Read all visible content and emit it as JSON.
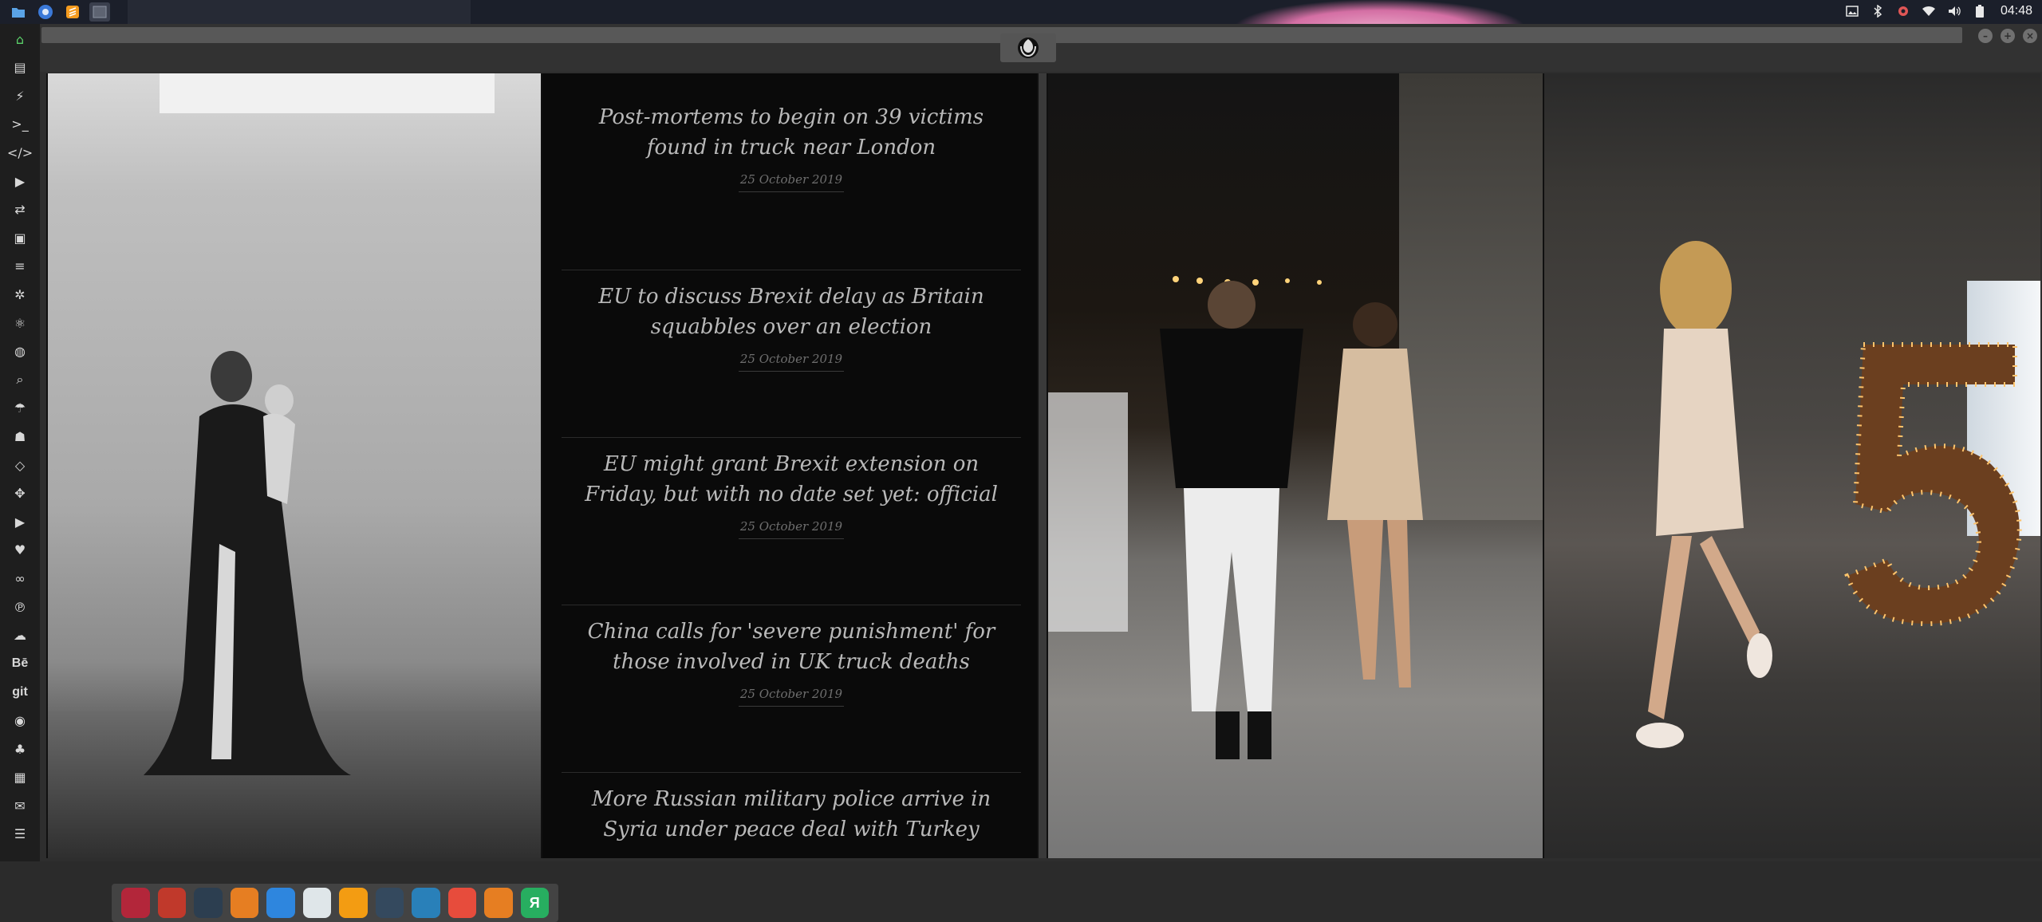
{
  "top_panel": {
    "clock": "04:48",
    "launchers": [
      "files-icon",
      "chromium-icon",
      "sublime-text-icon",
      "window-thumbnail-icon"
    ],
    "tray_icons": [
      "image-icon",
      "bluetooth-icon",
      "settings-gear-icon",
      "wifi-icon",
      "volume-icon",
      "battery-icon"
    ]
  },
  "left_launcher": {
    "items": [
      {
        "icon": "home-icon",
        "glyph": "⌂"
      },
      {
        "icon": "document-icon",
        "glyph": "▤"
      },
      {
        "icon": "bolt-icon",
        "glyph": "⚡"
      },
      {
        "icon": "terminal-icon",
        "glyph": ">_"
      },
      {
        "icon": "code-icon",
        "glyph": "</>"
      },
      {
        "icon": "play-icon",
        "glyph": "▶"
      },
      {
        "icon": "translate-icon",
        "glyph": "⇄"
      },
      {
        "icon": "image-icon",
        "glyph": "▣"
      },
      {
        "icon": "news-icon",
        "glyph": "≡"
      },
      {
        "icon": "settings-icon",
        "glyph": "✲"
      },
      {
        "icon": "react-icon",
        "glyph": "⚛"
      },
      {
        "icon": "globe-icon",
        "glyph": "◍"
      },
      {
        "icon": "search-icon",
        "glyph": "⌕"
      },
      {
        "icon": "umbrella-icon",
        "glyph": "☂"
      },
      {
        "icon": "contacts-icon",
        "glyph": "☗"
      },
      {
        "icon": "tag-icon",
        "glyph": "◇"
      },
      {
        "icon": "expand-icon",
        "glyph": "✥"
      },
      {
        "icon": "youtube-icon",
        "glyph": "▶"
      },
      {
        "icon": "heart-icon",
        "glyph": "♥"
      },
      {
        "icon": "infinity-icon",
        "glyph": "∞"
      },
      {
        "icon": "pinterest-icon",
        "glyph": "℗"
      },
      {
        "icon": "cloud-icon",
        "glyph": "☁"
      },
      {
        "icon": "behance-icon",
        "text": "Bē"
      },
      {
        "icon": "git-icon",
        "text": "git"
      },
      {
        "icon": "github-icon",
        "glyph": "◉"
      },
      {
        "icon": "gamepad-icon",
        "glyph": "♣"
      },
      {
        "icon": "map-icon",
        "glyph": "▦"
      },
      {
        "icon": "mail-icon",
        "glyph": "✉"
      },
      {
        "icon": "menu-icon",
        "glyph": "☰"
      }
    ]
  },
  "browser": {
    "tab_icon": "rebel-alliance-icon"
  },
  "news": {
    "items": [
      {
        "title": "Post-mortems to begin on 39 victims found in truck near London",
        "date": "25 October 2019"
      },
      {
        "title": "EU to discuss Brexit delay as Britain squabbles over an election",
        "date": "25 October 2019"
      },
      {
        "title": "EU might grant Brexit extension on Friday, but with no date set yet: official",
        "date": "25 October 2019"
      },
      {
        "title": "China calls for 'severe punishment' for those involved in UK truck deaths",
        "date": "25 October 2019"
      },
      {
        "title": "More Russian military police arrive in Syria under peace deal with Turkey",
        "date": ""
      }
    ]
  },
  "dock": {
    "apps": [
      {
        "icon": "arch-icon",
        "label": "",
        "color": "#b3263a"
      },
      {
        "icon": "hourglass-icon",
        "label": "",
        "color": "#c0392b"
      },
      {
        "icon": "earth-icon",
        "label": "",
        "color": "#2c3e50"
      },
      {
        "icon": "photos-icon",
        "label": "",
        "color": "#e67e22"
      },
      {
        "icon": "translate-app-icon",
        "label": "",
        "color": "#2e86de"
      },
      {
        "icon": "news-reader-icon",
        "label": "",
        "color": "#dfe6e9"
      },
      {
        "icon": "magnifier-icon",
        "label": "",
        "color": "#f39c12"
      },
      {
        "icon": "clock-icon",
        "label": "",
        "color": "#34495e"
      },
      {
        "icon": "globe-app-icon",
        "label": "",
        "color": "#2980b9"
      },
      {
        "icon": "calendar-icon",
        "label": "",
        "color": "#e74c3c"
      },
      {
        "icon": "play-arrow-icon",
        "label": "",
        "color": "#e67e22"
      },
      {
        "icon": "yandex-icon",
        "label": "Я",
        "color": "#27ae60"
      }
    ]
  }
}
